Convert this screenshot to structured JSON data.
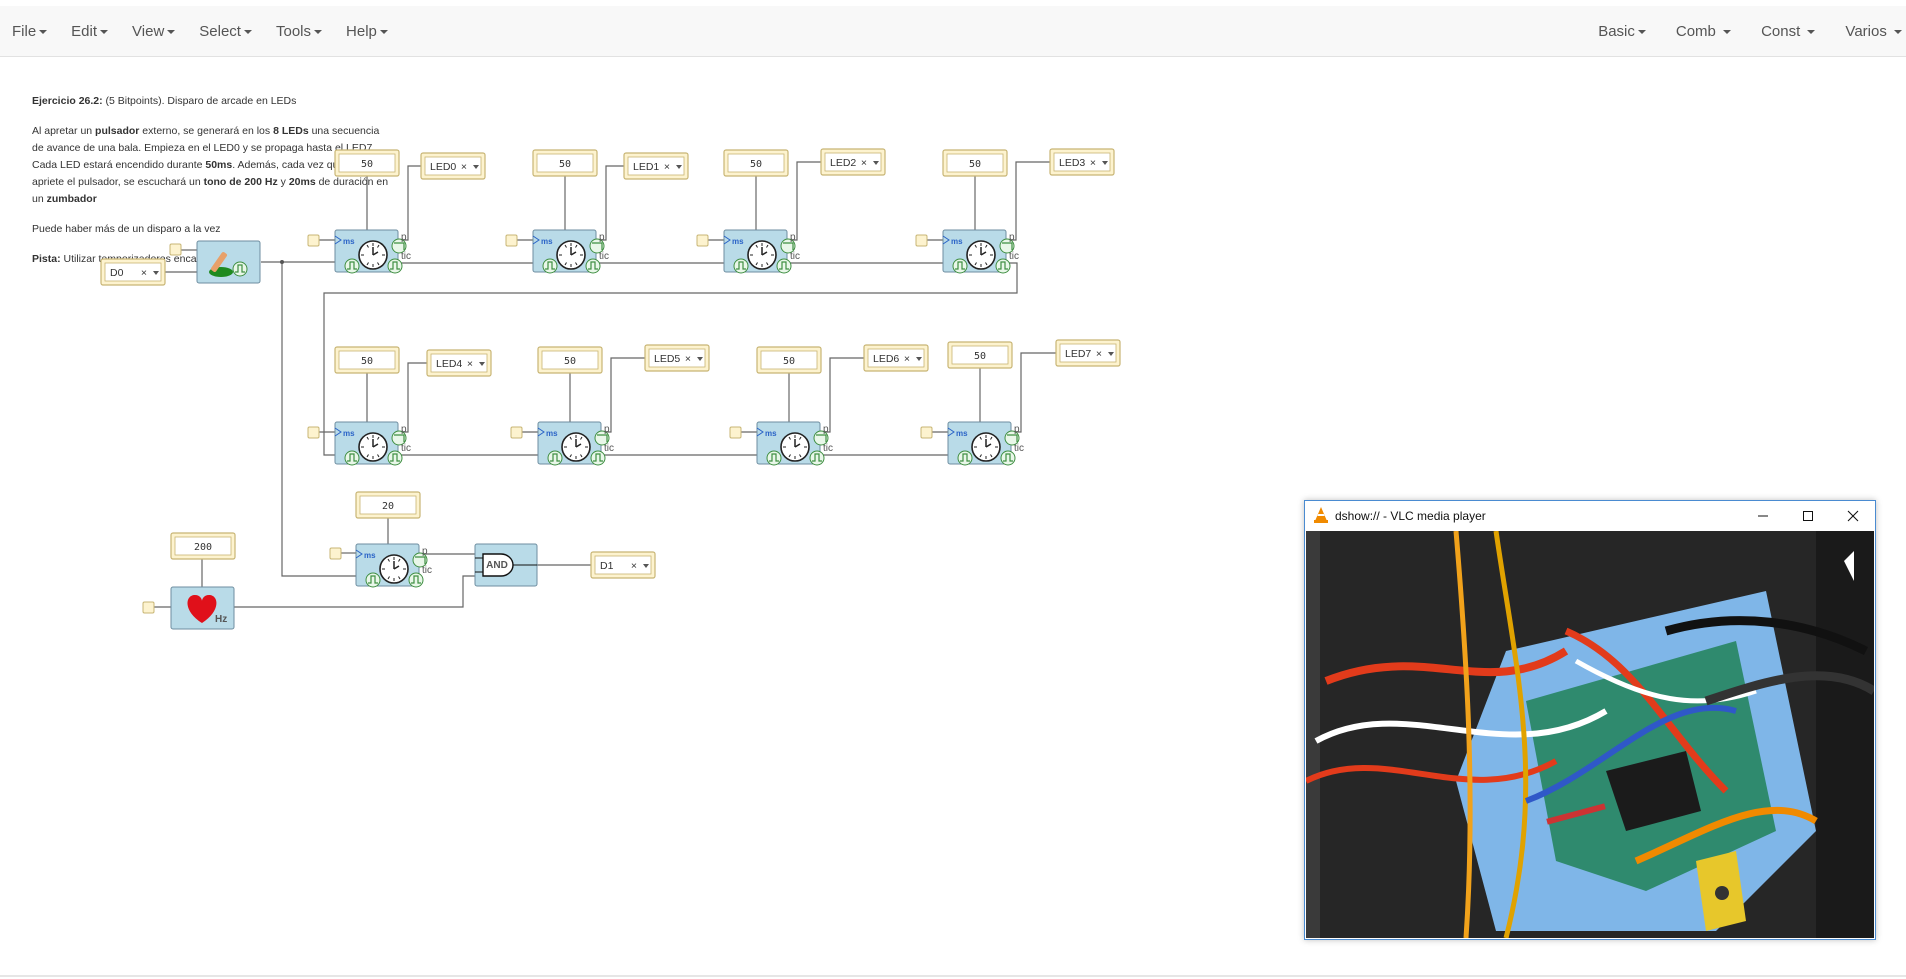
{
  "menus": {
    "left": [
      "File",
      "Edit",
      "View",
      "Select",
      "Tools",
      "Help"
    ],
    "right": [
      "Basic",
      "Comb",
      "Const",
      "Varios"
    ]
  },
  "description": {
    "title_bold": "Ejercicio 26.2:",
    "title_rest": " (5 Bitpoints). Disparo de arcade en LEDs",
    "p1_a": "Al apretar un ",
    "p1_b": "pulsador",
    "p1_c": " externo, se generará en los ",
    "p1_d": "8 LEDs",
    "p1_e": " una secuencia de avance de una bala. Empieza en el LED0 y se propaga hasta el LED7. Cada LED estará encendido durante ",
    "p1_f": "50ms",
    "p1_g": ". Además, cada vez que se apriete el pulsador, se escuchará un ",
    "p1_h": "tono de 200 Hz",
    "p1_i": " y ",
    "p1_j": "20ms",
    "p1_k": " de duración en un ",
    "p1_l": "zumbador",
    "p2": "Puede haber más de un disparo a la vez",
    "p3_bold": "Pista:",
    "p3_rest": " Utilizar temporizadores encadenados"
  },
  "circuit": {
    "input_pin": "D0",
    "output_pin": "D1",
    "timer_labels": {
      "ms": "ms",
      "p": "p",
      "tic": "tic"
    },
    "led_timers": [
      {
        "const": "50",
        "led": "LED0"
      },
      {
        "const": "50",
        "led": "LED1"
      },
      {
        "const": "50",
        "led": "LED2"
      },
      {
        "const": "50",
        "led": "LED3"
      },
      {
        "const": "50",
        "led": "LED4"
      },
      {
        "const": "50",
        "led": "LED5"
      },
      {
        "const": "50",
        "led": "LED6"
      },
      {
        "const": "50",
        "led": "LED7"
      }
    ],
    "tone_timer_const": "20",
    "buzzer_freq": "200",
    "buzzer_unit": "Hz",
    "and_gate_label": "AND",
    "remove_glyph": "×"
  },
  "vlc": {
    "title": "dshow:// - VLC media player",
    "buttons": [
      "minimize-icon",
      "maximize-icon",
      "close-icon"
    ]
  },
  "colors": {
    "navbar_bg": "#f8f8f8",
    "block_fill": "#b9dbe8",
    "const_fill": "#fdf3cf",
    "heart": "#e0101a",
    "vlc_border": "#4a8bd1"
  }
}
